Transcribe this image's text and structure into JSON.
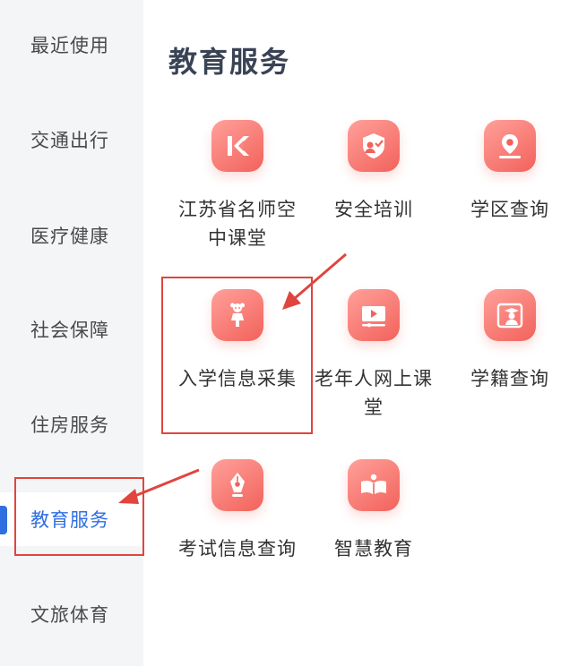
{
  "sidebar": {
    "items": [
      {
        "label": "最近使用"
      },
      {
        "label": "交通出行"
      },
      {
        "label": "医疗健康"
      },
      {
        "label": "社会保障"
      },
      {
        "label": "住房服务"
      },
      {
        "label": "教育服务",
        "active": true
      },
      {
        "label": "文旅体育"
      }
    ]
  },
  "main": {
    "title": "教育服务",
    "services": [
      {
        "label": "江苏省名师空中课堂",
        "icon": "k-logo-icon"
      },
      {
        "label": "安全培训",
        "icon": "shield-person-icon"
      },
      {
        "label": "学区查询",
        "icon": "location-pin-icon"
      },
      {
        "label": "入学信息采集",
        "icon": "child-icon"
      },
      {
        "label": "老年人网上课堂",
        "icon": "video-play-icon"
      },
      {
        "label": "学籍查询",
        "icon": "graduate-card-icon"
      },
      {
        "label": "考试信息查询",
        "icon": "pen-nib-icon"
      },
      {
        "label": "智慧教育",
        "icon": "open-book-icon"
      }
    ]
  },
  "colors": {
    "accent": "#2f6fe0",
    "icon_gradient_start": "#ffa09a",
    "icon_gradient_end": "#f2625b",
    "annotation": "#e0453e"
  }
}
